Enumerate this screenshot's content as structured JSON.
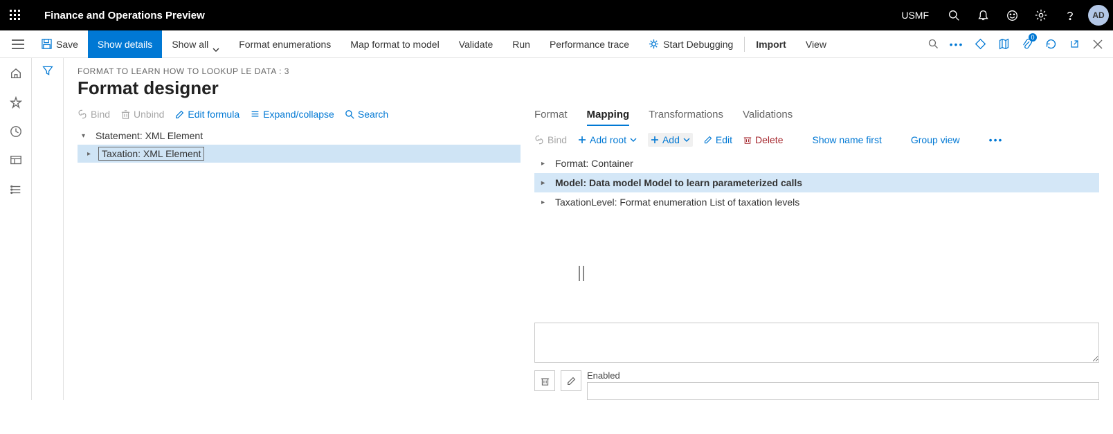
{
  "topbar": {
    "title": "Finance and Operations Preview",
    "company": "USMF",
    "avatar": "AD"
  },
  "cmdbar": {
    "save": "Save",
    "show_details": "Show details",
    "show_all": "Show all",
    "format_enum": "Format enumerations",
    "map_format": "Map format to model",
    "validate": "Validate",
    "run": "Run",
    "perf_trace": "Performance trace",
    "start_debug": "Start Debugging",
    "import": "Import",
    "view": "View",
    "badge_count": "0"
  },
  "page": {
    "breadcrumb": "FORMAT TO LEARN HOW TO LOOKUP LE DATA : 3",
    "title": "Format designer"
  },
  "left_toolbar": {
    "bind": "Bind",
    "unbind": "Unbind",
    "edit_formula": "Edit formula",
    "expand": "Expand/collapse",
    "search": "Search"
  },
  "left_tree": {
    "root": "Statement: XML Element",
    "child": "Taxation: XML Element"
  },
  "tabs": {
    "format": "Format",
    "mapping": "Mapping",
    "transformations": "Transformations",
    "validations": "Validations"
  },
  "right_toolbar": {
    "bind": "Bind",
    "add_root": "Add root",
    "add": "Add",
    "edit": "Edit",
    "delete": "Delete",
    "show_name": "Show name first",
    "group_view": "Group view"
  },
  "right_tree": {
    "r1": "Format: Container",
    "r2": "Model: Data model Model to learn parameterized calls",
    "r3": "TaxationLevel: Format enumeration List of taxation levels"
  },
  "bottom": {
    "enabled_label": "Enabled"
  }
}
